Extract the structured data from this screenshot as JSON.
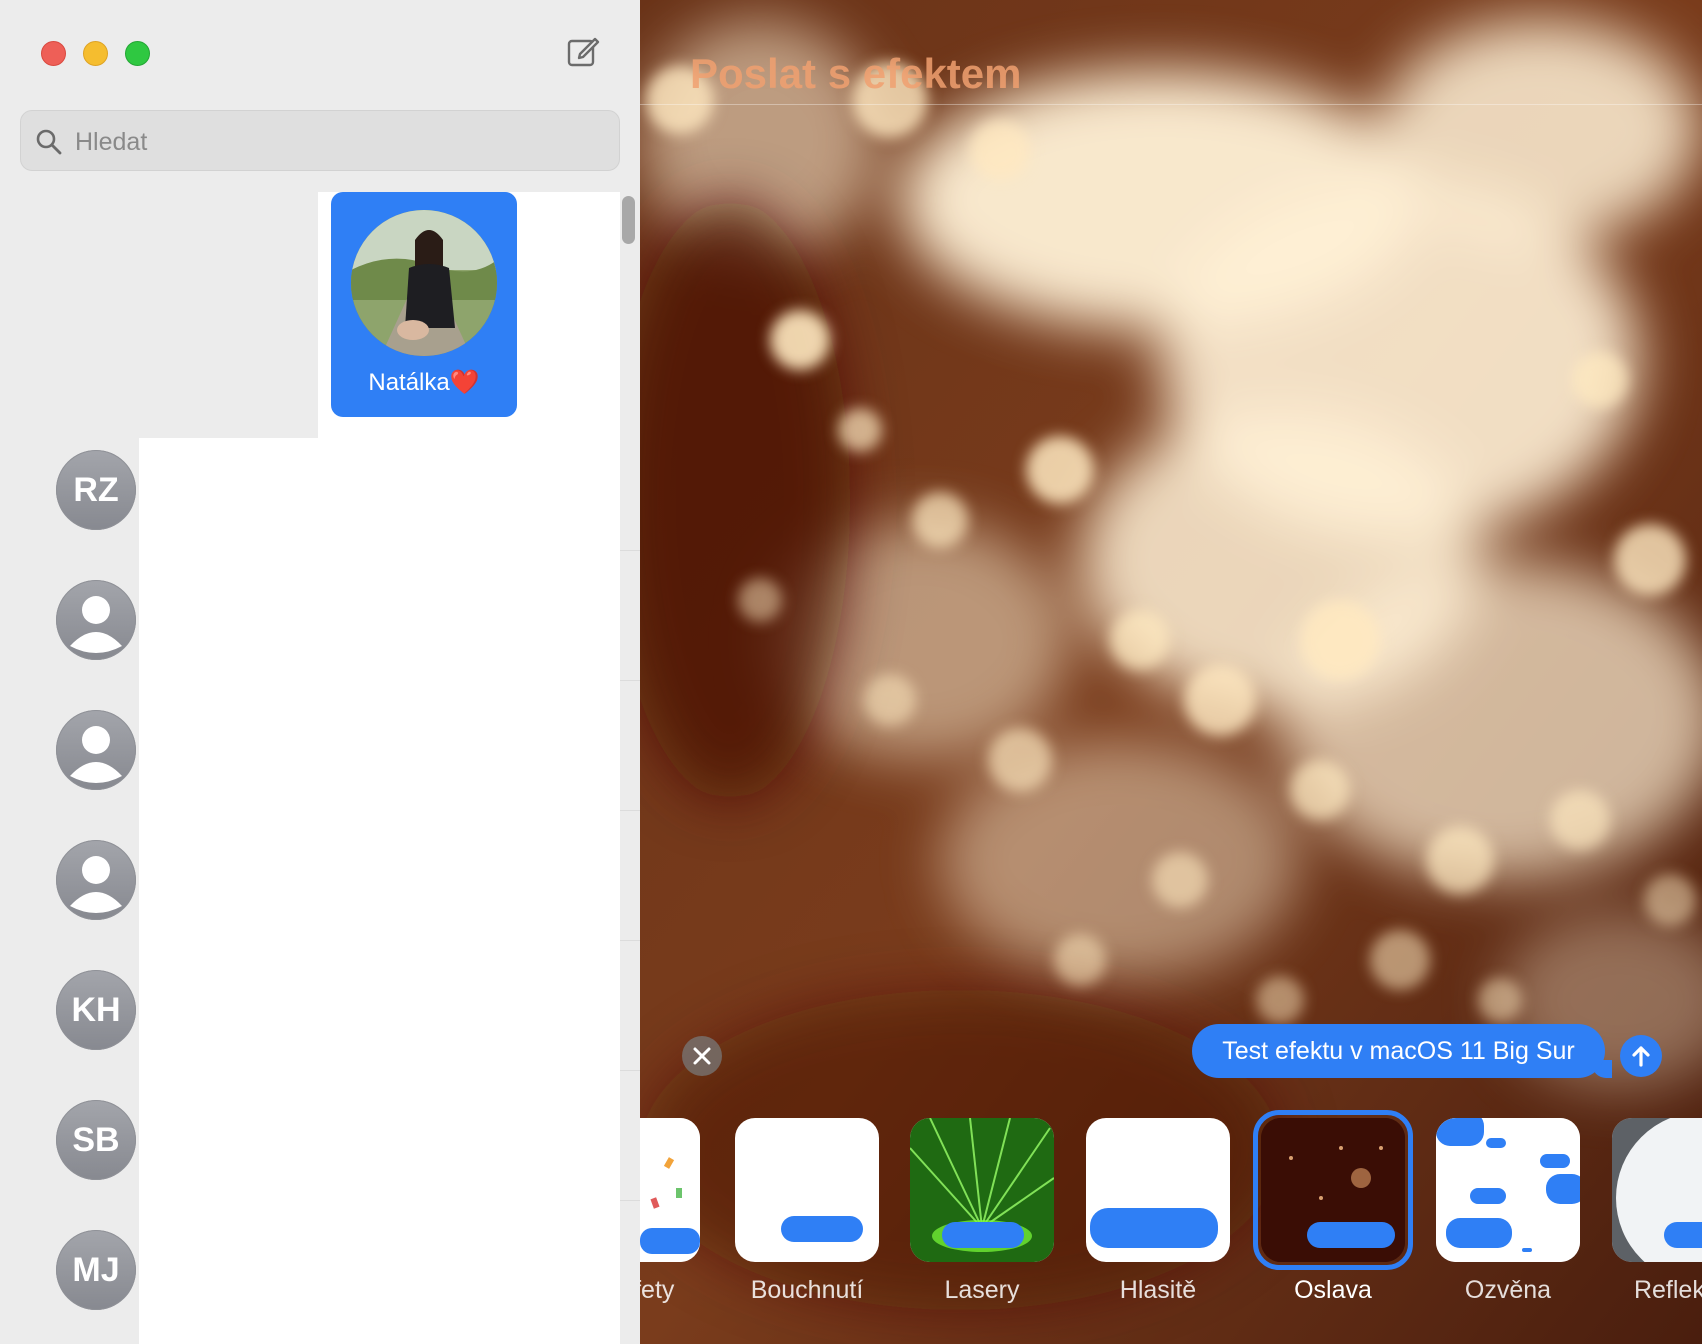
{
  "sidebar": {
    "search_placeholder": "Hledat",
    "pinned": {
      "name": "Natálka❤️"
    },
    "avatars": [
      "RZ",
      "",
      "",
      "",
      "KH",
      "SB",
      "MJ"
    ]
  },
  "effect_panel": {
    "title": "Poslat s efektem",
    "message": "Test efektu v macOS 11 Big Sur",
    "effects": [
      {
        "label": "Konfety"
      },
      {
        "label": "Bouchnutí"
      },
      {
        "label": "Lasery"
      },
      {
        "label": "Hlasitě"
      },
      {
        "label": "Oslava"
      },
      {
        "label": "Ozvěna"
      },
      {
        "label": "Reflektor"
      }
    ],
    "selected_effect": "Oslava"
  },
  "colors": {
    "accent": "#2f7ff5",
    "sidebar_bg": "#ececec"
  }
}
